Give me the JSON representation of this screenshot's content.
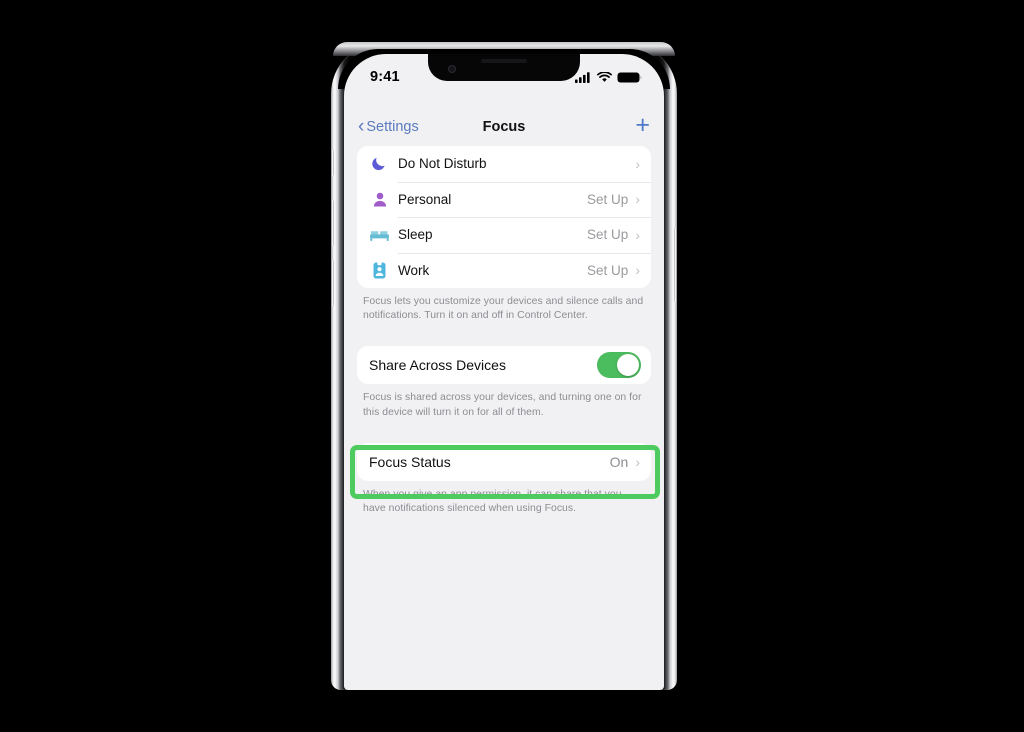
{
  "device": {
    "kind": "iphone-frame",
    "status_bar": {
      "time": "9:41",
      "icons": [
        "cellular-signal-icon",
        "wifi-icon",
        "battery-icon"
      ]
    }
  },
  "nav": {
    "back_label": "Settings",
    "back_icon": "chevron-left-icon",
    "title": "Focus",
    "add_icon": "plus-icon",
    "accent_color": "#4f79c9"
  },
  "focus_list": {
    "rows": [
      {
        "label": "Do Not Disturb",
        "value": "",
        "icon": "moon-icon",
        "icon_color": "#5b5bd6"
      },
      {
        "label": "Personal",
        "value": "Set Up",
        "icon": "person-icon",
        "icon_color": "#a05cc8"
      },
      {
        "label": "Sleep",
        "value": "Set Up",
        "icon": "bed-icon",
        "icon_color": "#66bcd4"
      },
      {
        "label": "Work",
        "value": "Set Up",
        "icon": "badge-icon",
        "icon_color": "#4fb6dd"
      }
    ],
    "chevron": "›",
    "footnote": "Focus lets you customize your devices and silence calls and notifications. Turn it on and off in Control Center."
  },
  "share_section": {
    "label": "Share Across Devices",
    "toggle_state": "on",
    "toggle_color": "#4cbd5f",
    "footnote": "Focus is shared across your devices, and turning one on for this device will turn it on for all of them."
  },
  "status_section": {
    "label": "Focus Status",
    "value": "On",
    "chevron": "›",
    "footnote": "When you give an app permission, it can share that you have notifications silenced when using Focus."
  },
  "annotation": {
    "type": "highlight-rectangle",
    "target": "Focus Status",
    "color": "#4ecb5e"
  }
}
